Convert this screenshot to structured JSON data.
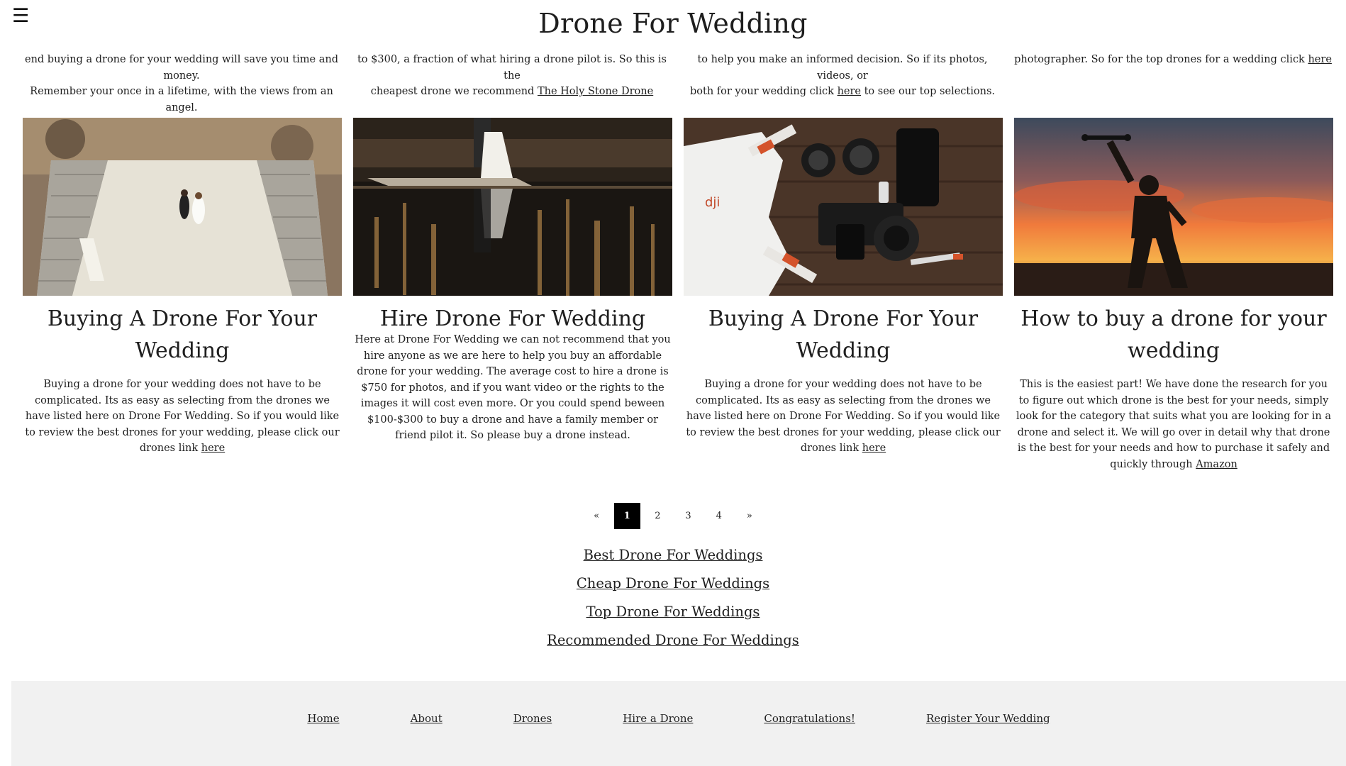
{
  "header": {
    "title": "Drone For Wedding",
    "menu_icon": "hamburger-icon"
  },
  "top_snippets": [
    {
      "lines": [
        "end buying a drone for your wedding will save you time and money.",
        "Remember your once in a lifetime, with the views from an angel."
      ],
      "link": ""
    },
    {
      "lines": [
        "to $300, a fraction of what hiring a drone pilot is. So this is the",
        "cheapest drone we recommend "
      ],
      "link": "The Holy Stone Drone",
      "after": ""
    },
    {
      "lines": [
        "to help you make an informed decision. So if its photos, videos, or",
        "both for your wedding click "
      ],
      "link": "here",
      "after": " to see our top selections."
    },
    {
      "lines": [
        "photographer. So for the top drones for a wedding click "
      ],
      "link": "here",
      "after": ""
    }
  ],
  "cards": [
    {
      "image_alt": "aerial view of wedding couple lying on plaza between stairs",
      "title": "Buying A Drone For Your Wedding",
      "text": "Buying a drone for your wedding does not have to be complicated. Its as easy as selecting from the drones we have listed here on Drone For Wedding. So if you would like to review the best drones for your wedding, please click our drones link ",
      "link": "here"
    },
    {
      "image_alt": "wedding couple on dock reflected in lake",
      "title": "Hire Drone For Wedding",
      "text": "Here at Drone For Wedding we can not recommend that you hire anyone as we are here to help you buy an affordable drone for your wedding. The average cost to hire a drone is $750 for photos, and if you want video or the rights to the images it will cost even more. Or you could spend beween $100-$300 to buy a drone and have a family member or friend pilot it. So please buy a drone instead.",
      "link": ""
    },
    {
      "image_alt": "white drone and camera gear on wooden table",
      "title": "Buying A Drone For Your Wedding",
      "text": "Buying a drone for your wedding does not have to be complicated. Its as easy as selecting from the drones we have listed here on Drone For Wedding. So if you would like to review the best drones for your wedding, please click our drones link ",
      "link": "here"
    },
    {
      "image_alt": "silhouette of man holding drone against sunset sky",
      "title": "How to buy a drone for your wedding",
      "text": "This is the easiest part! We have done the research for you to figure out which drone is the best for your needs, simply look for the category that suits what you are looking for in a drone and select it. We will go over in detail why that drone is the best for your needs and how to purchase it safely and quickly through ",
      "link": "Amazon"
    }
  ],
  "pagination": {
    "prev": "«",
    "pages": [
      "1",
      "2",
      "3",
      "4"
    ],
    "active": "1",
    "next": "»"
  },
  "extra_links": [
    "Best Drone For Weddings",
    "Cheap Drone For Weddings",
    "Top Drone For Weddings",
    "Recommended Drone For Weddings"
  ],
  "footer": {
    "nav": [
      "Home",
      "About",
      "Drones",
      "Hire a Drone",
      "Congratulations!",
      "Register Your Wedding"
    ]
  }
}
